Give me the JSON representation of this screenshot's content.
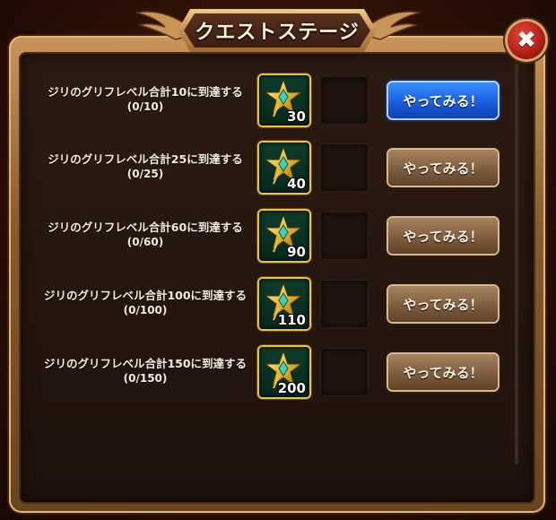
{
  "dialog": {
    "title": "クエストステージ",
    "close_glyph": "✖"
  },
  "quests": [
    {
      "name": "ジリのグリフレベル合計10に到達する",
      "progress": "(0/10)",
      "reward_amount": "30",
      "button_label": "やってみる！",
      "button_state": "active"
    },
    {
      "name": "ジリのグリフレベル合計25に到達する",
      "progress": "(0/25)",
      "reward_amount": "40",
      "button_label": "やってみる！",
      "button_state": "inactive"
    },
    {
      "name": "ジリのグリフレベル合計60に到達する",
      "progress": "(0/60)",
      "reward_amount": "90",
      "button_label": "やってみる！",
      "button_state": "inactive"
    },
    {
      "name": "ジリのグリフレベル合計100に到達する",
      "progress": "(0/100)",
      "reward_amount": "110",
      "button_label": "やってみる！",
      "button_state": "inactive"
    },
    {
      "name": "ジリのグリフレベル合計150に到達する",
      "progress": "(0/150)",
      "reward_amount": "200",
      "button_label": "やってみる！",
      "button_state": "inactive"
    }
  ],
  "icons": {
    "reward": "glyph-star-icon",
    "close": "close-icon"
  },
  "colors": {
    "active_button": "#1b5fe0",
    "inactive_button": "#7e5d3e",
    "reward_border": "#e8c04a"
  }
}
